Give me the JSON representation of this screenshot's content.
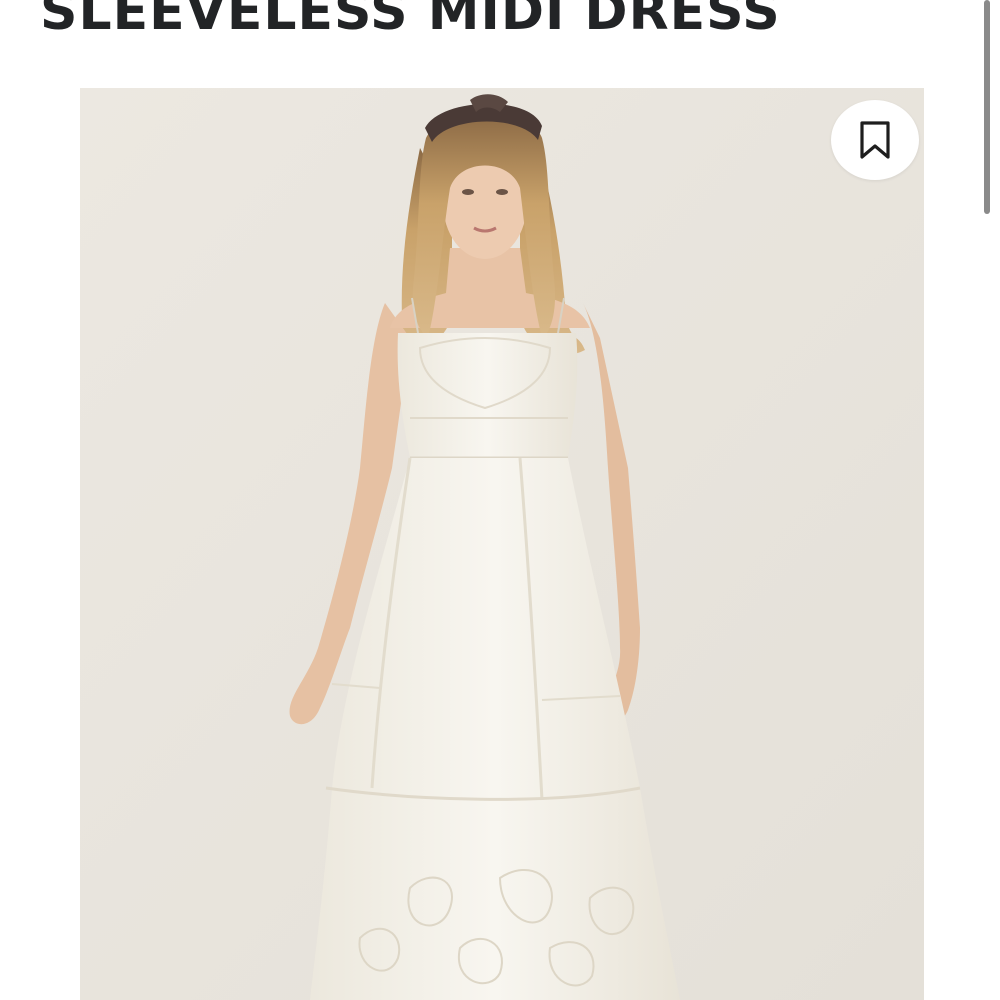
{
  "product": {
    "title": "SLEEVELESS MIDI DRESS",
    "image_alt": "Model wearing a white sleeveless midi dress with eyelet embroidery and a patterned headband"
  },
  "actions": {
    "save_icon": "bookmark-icon"
  },
  "colors": {
    "title_text": "#222426",
    "image_background": "#eae6df",
    "dress": "#f6f3ec",
    "hair": "#c9a26a",
    "skin": "#e8c3a6",
    "headband": "#4a3a36",
    "scrollbar": "#8a8a8a"
  }
}
